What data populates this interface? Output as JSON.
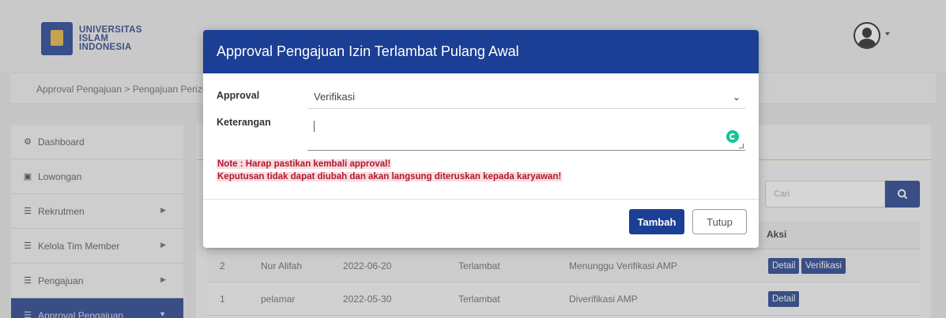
{
  "brand": {
    "line1": "UNIVERSITAS",
    "line2": "ISLAM",
    "line3": "INDONESIA"
  },
  "breadcrumb": "Approval Pengajuan > Pengajuan Perizin",
  "sidebar": {
    "items": [
      {
        "label": "Dashboard",
        "icon": "dashboard-icon"
      },
      {
        "label": "Lowongan",
        "icon": "briefcase-icon"
      },
      {
        "label": "Rekrutmen",
        "icon": "list-icon"
      },
      {
        "label": "Kelola Tim Member",
        "icon": "list-icon"
      },
      {
        "label": "Pengajuan",
        "icon": "list-icon"
      },
      {
        "label": "Approval Pengajuan",
        "icon": "list-icon"
      }
    ]
  },
  "search": {
    "placeholder": "Cari"
  },
  "table": {
    "aksi_header": "Aksi",
    "rows": [
      {
        "no": "2",
        "name": "Nur Alifah",
        "date": "2022-06-20",
        "type": "Terlambat",
        "status": "Menunggu Verifikasi AMP",
        "actions": [
          "Detail",
          "Verifikasi"
        ]
      },
      {
        "no": "1",
        "name": "pelamar",
        "date": "2022-05-30",
        "type": "Terlambat",
        "status": "Diverifikasi AMP",
        "actions": [
          "Detail"
        ]
      }
    ]
  },
  "modal": {
    "title": "Approval Pengajuan Izin Terlambat Pulang Awal",
    "approval_label": "Approval",
    "approval_value": "Verifikasi",
    "keterangan_label": "Keterangan",
    "note_line1": "Note : Harap pastikan kembali approval!",
    "note_line2": "Keputusan tidak dapat diubah dan akan langsung diteruskan kepada karyawan!",
    "submit_label": "Tambah",
    "close_label": "Tutup"
  },
  "colors": {
    "primary": "#1a3f95",
    "note_text": "#b0182c",
    "note_bg": "#f8dde1",
    "accent_line": "#e0c36a"
  }
}
